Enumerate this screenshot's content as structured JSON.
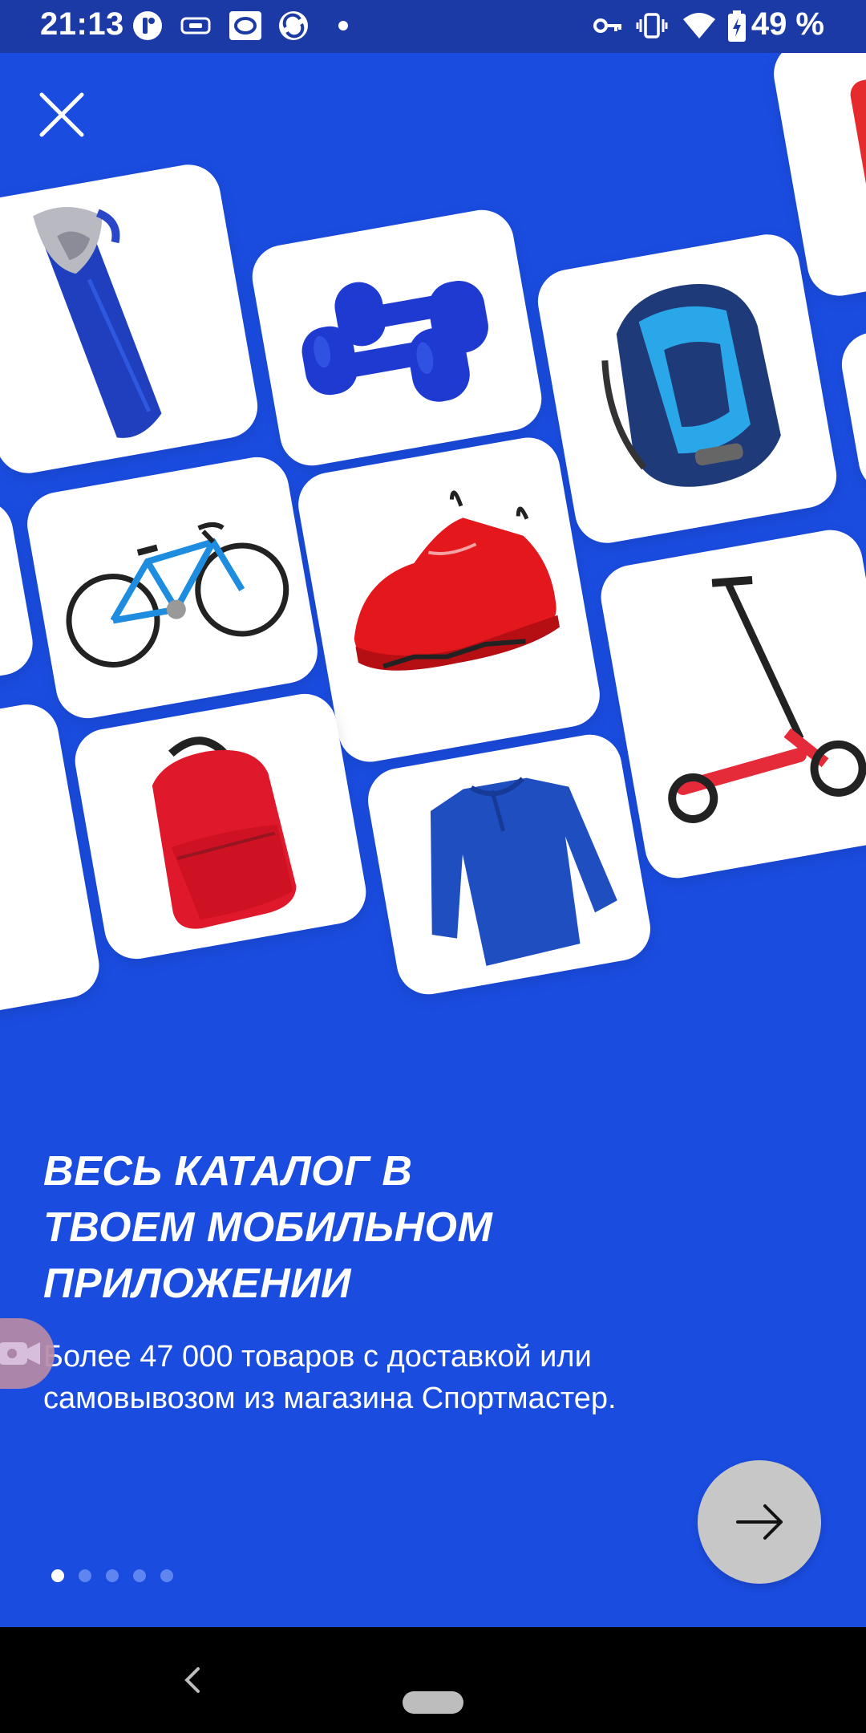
{
  "status_bar": {
    "time": "21:13",
    "battery": "49 %",
    "icons": [
      "app-notification-icon",
      "pay-card-icon",
      "opera-icon",
      "app-refresh-icon",
      "dot-icon",
      "key-icon",
      "vibrate-icon",
      "wifi-icon",
      "battery-charging-icon"
    ]
  },
  "onboarding": {
    "title_line1": "ВЕСЬ КАТАЛОГ В",
    "title_line2": "ТВОЕМ МОБИЛЬНОМ",
    "title_line3": "ПРИЛОЖЕНИИ",
    "description_line1": "Более 47 000 товаров с доставкой или",
    "description_line2": "самовывозом из магазина Спортмастер.",
    "page_count": 5,
    "current_page": 1
  },
  "products": [
    "sleeping-bag",
    "dumbbells",
    "backpack-blue",
    "bicycle",
    "sneaker-red",
    "scooter",
    "backpack-red",
    "sweater-blue"
  ],
  "colors": {
    "background": "#1a4ce0",
    "status_bar": "#1b3aa6",
    "next_button": "#c7c7c7",
    "dot_active": "#ffffff",
    "dot_inactive": "#5f86f0"
  }
}
